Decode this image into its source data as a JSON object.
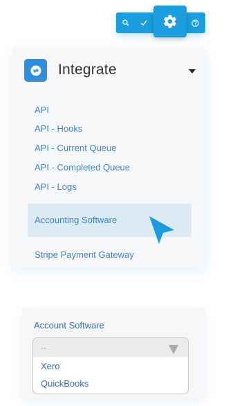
{
  "toolbar": {
    "buttons": [
      {
        "icon": "search-icon"
      },
      {
        "icon": "check-icon"
      },
      {
        "icon": "gear-icon",
        "active": true
      },
      {
        "icon": "help-icon"
      }
    ],
    "color": "#1a9ee0"
  },
  "integrate": {
    "title": "Integrate",
    "icon": "sync-icon",
    "links": [
      "API",
      "API - Hooks",
      "API - Current Queue",
      "API - Completed Queue",
      "API - Logs"
    ],
    "selected": "Accounting Software",
    "after": "Stripe Payment Gateway"
  },
  "account_software": {
    "label": "Account Software",
    "current": "--",
    "options": [
      "Xero",
      "QuickBooks"
    ]
  },
  "colors": {
    "accent": "#1a9ee0",
    "link": "#3a83d4",
    "highlight": "#dbeaf3"
  }
}
